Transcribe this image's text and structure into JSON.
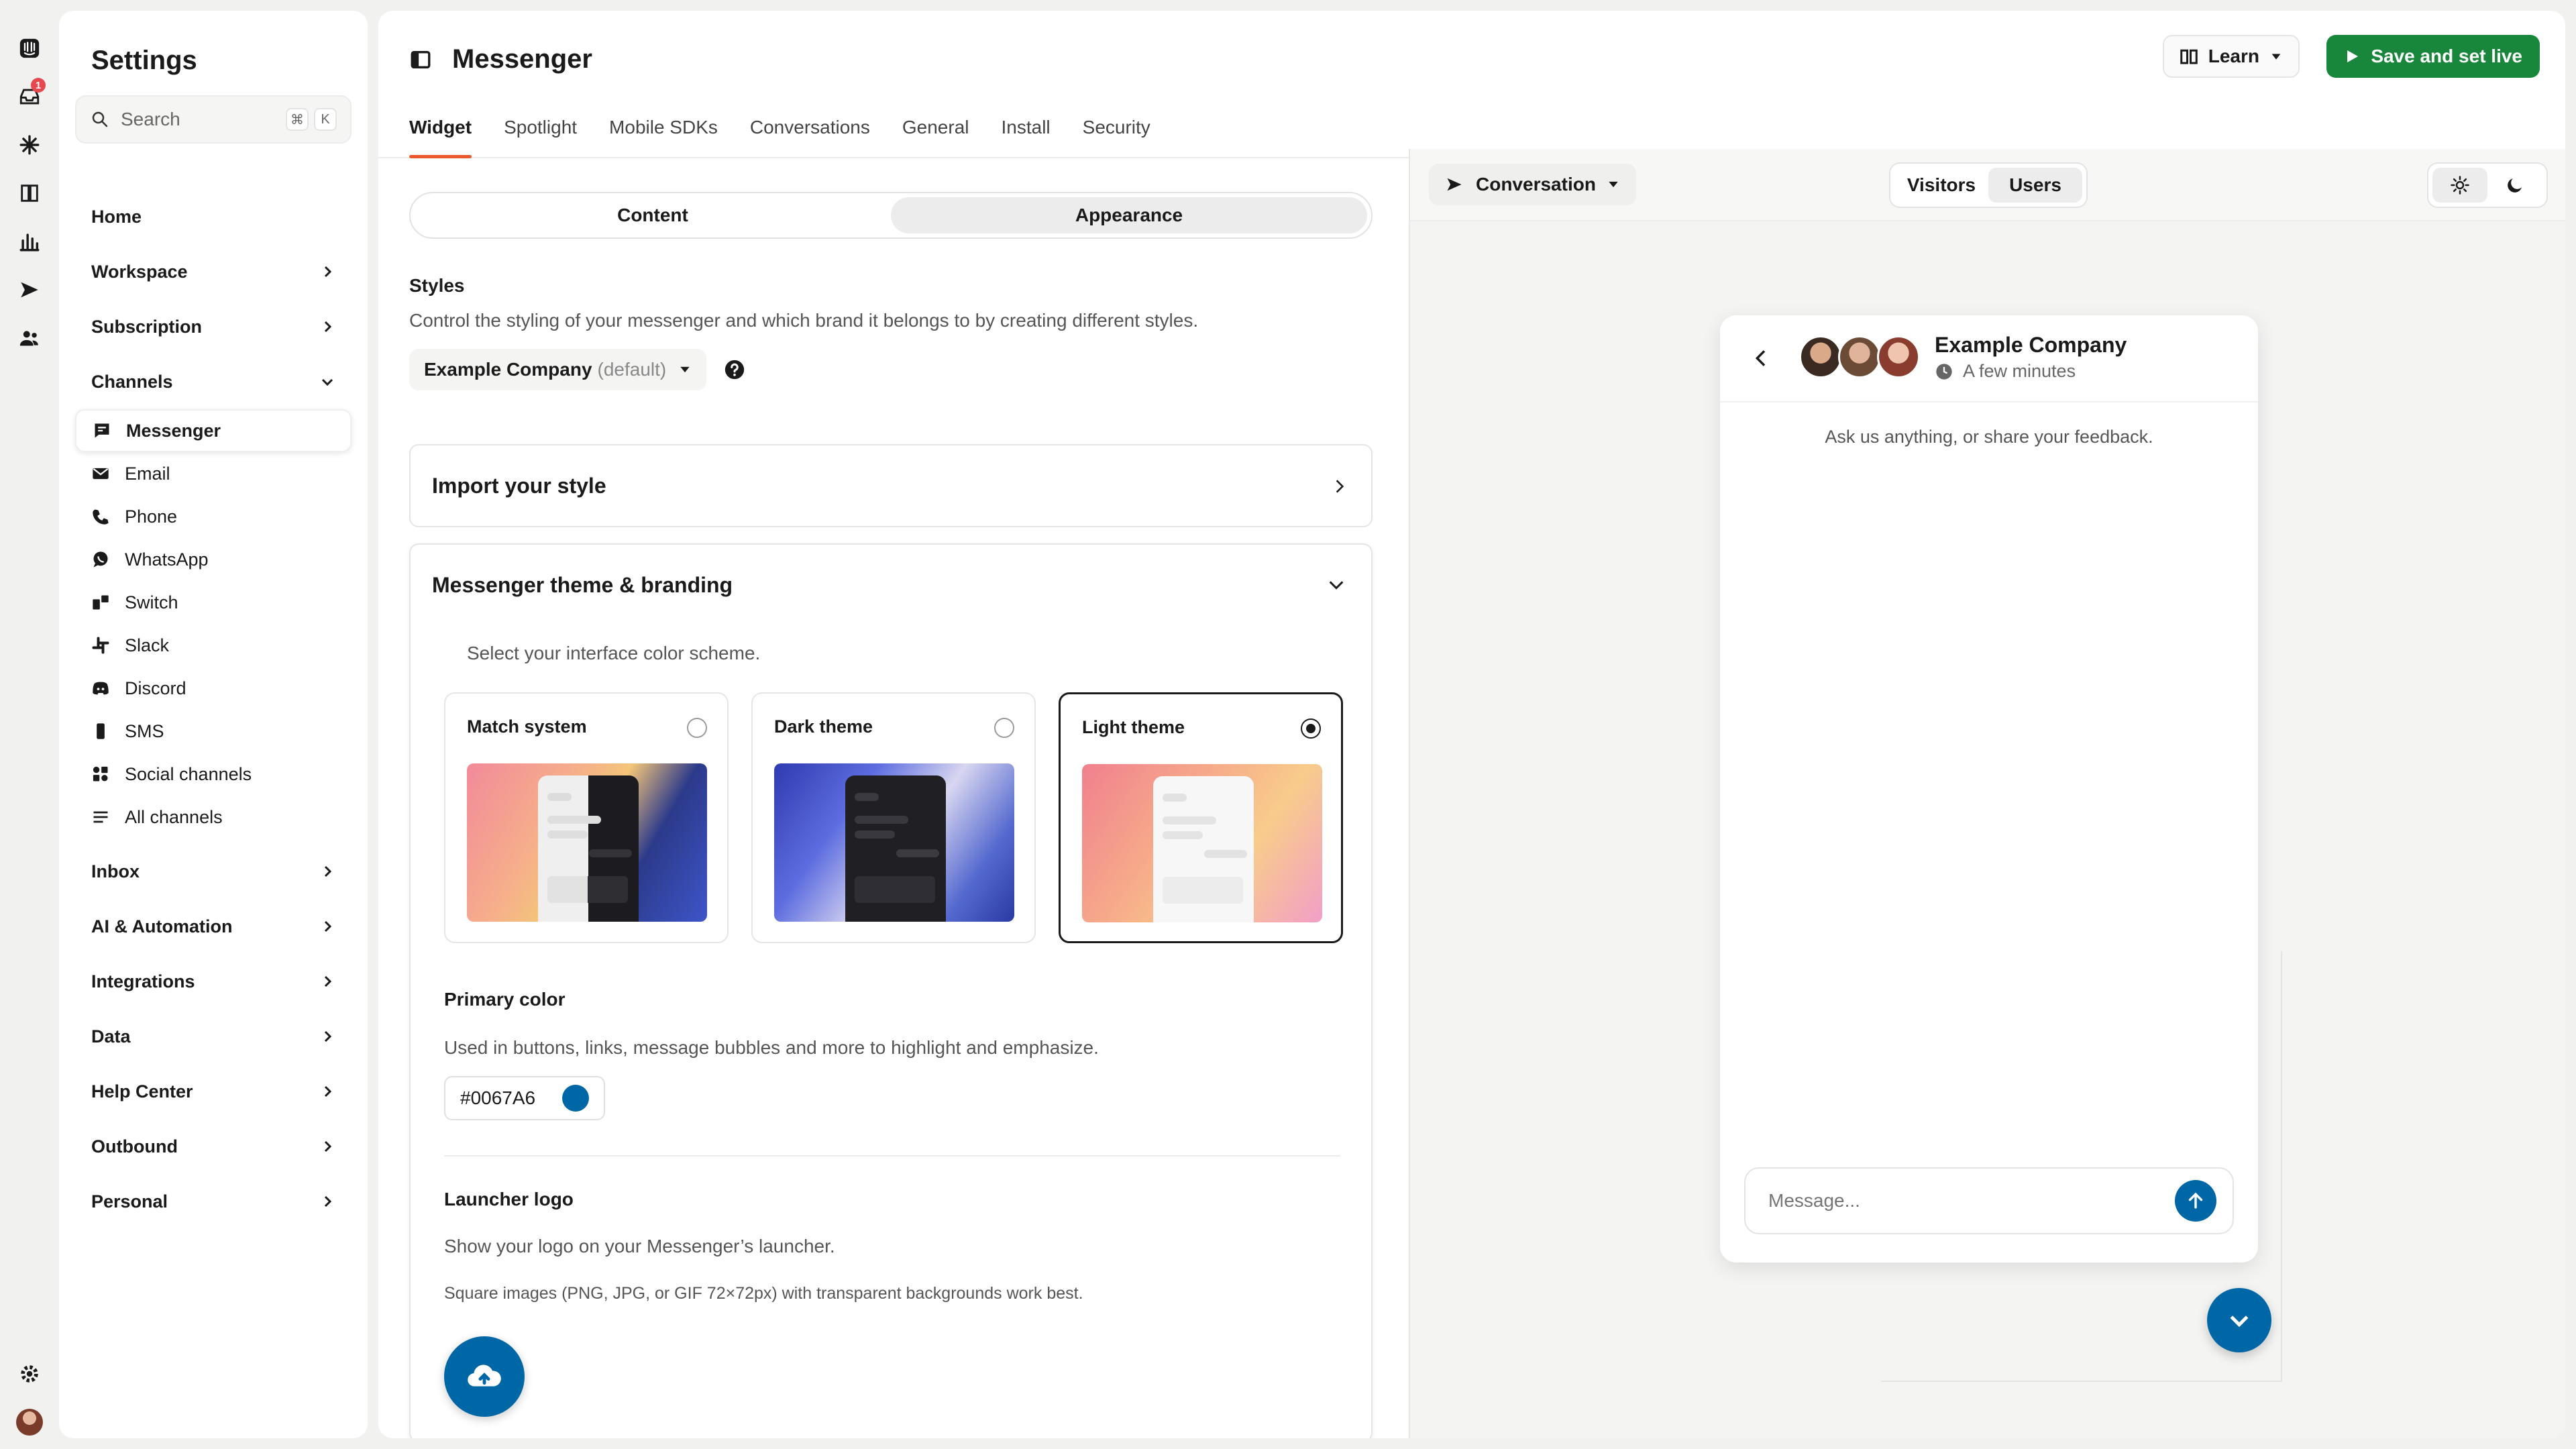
{
  "rail": {
    "inbox_badge": "1"
  },
  "sidebar": {
    "title": "Settings",
    "search": {
      "placeholder": "Search",
      "kbd1": "⌘",
      "kbd2": "K"
    },
    "items": [
      {
        "label": "Home"
      },
      {
        "label": "Workspace"
      },
      {
        "label": "Subscription"
      },
      {
        "label": "Channels"
      }
    ],
    "channels": [
      {
        "label": "Messenger",
        "icon": "messenger-icon"
      },
      {
        "label": "Email",
        "icon": "email-icon"
      },
      {
        "label": "Phone",
        "icon": "phone-icon"
      },
      {
        "label": "WhatsApp",
        "icon": "whatsapp-icon"
      },
      {
        "label": "Switch",
        "icon": "switch-icon"
      },
      {
        "label": "Slack",
        "icon": "slack-icon"
      },
      {
        "label": "Discord",
        "icon": "discord-icon"
      },
      {
        "label": "SMS",
        "icon": "sms-icon"
      },
      {
        "label": "Social channels",
        "icon": "social-icon"
      },
      {
        "label": "All channels",
        "icon": "list-icon"
      }
    ],
    "items_after": [
      {
        "label": "Inbox"
      },
      {
        "label": "AI & Automation"
      },
      {
        "label": "Integrations"
      },
      {
        "label": "Data"
      },
      {
        "label": "Help Center"
      },
      {
        "label": "Outbound"
      },
      {
        "label": "Personal"
      }
    ]
  },
  "header": {
    "title": "Messenger",
    "learn_label": "Learn",
    "save_label": "Save and set live",
    "tabs": [
      "Widget",
      "Spotlight",
      "Mobile SDKs",
      "Conversations",
      "General",
      "Install",
      "Security"
    ]
  },
  "config": {
    "segment": [
      "Content",
      "Appearance"
    ],
    "styles_heading": "Styles",
    "styles_desc": "Control the styling of your messenger and which brand it belongs to by creating different styles.",
    "style_name": "Example Company",
    "style_suffix": "(default)",
    "import_title": "Import your style",
    "theme_title": "Messenger theme & branding",
    "theme_desc": "Select your interface color scheme.",
    "themes": [
      "Match system",
      "Dark theme",
      "Light theme"
    ],
    "selected_theme": "Light theme",
    "primary_heading": "Primary color",
    "primary_desc": "Used in buttons, links, message bubbles and more to highlight and emphasize.",
    "primary_value": "#0067A6",
    "launcher_heading": "Launcher logo",
    "launcher_desc": "Show your logo on your Messenger’s launcher.",
    "launcher_note": "Square images (PNG, JPG, or GIF 72×72px) with transparent backgrounds work best."
  },
  "preview": {
    "conversation_label": "Conversation",
    "audience": [
      "Visitors",
      "Users"
    ],
    "selected_audience": "Users",
    "company": "Example Company",
    "reply_time": "A few minutes",
    "intro": "Ask us anything, or share your feedback.",
    "composer_placeholder": "Message..."
  },
  "colors": {
    "primary": "#0067A6",
    "save_green": "#18873b",
    "tab_accent": "#e9572b"
  }
}
